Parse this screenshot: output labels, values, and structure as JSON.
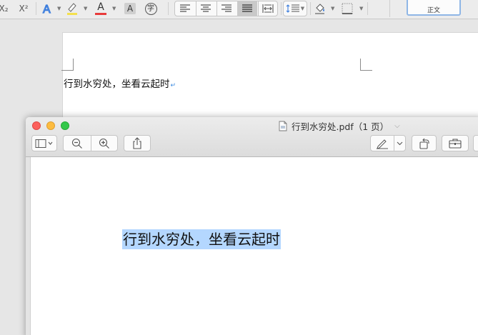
{
  "word": {
    "toolbar": {
      "subscript_label": "X₂",
      "superscript_label": "X²",
      "font_color_label": "A",
      "shading_label": "A",
      "phonetic_label": "字",
      "style_label": "正文",
      "colors": {
        "highlight": "#f4e04d",
        "font_color": "#e83b3b",
        "accent": "#3b7ddd"
      }
    },
    "document": {
      "text": "行到水穷处，坐看云起时",
      "paragraph_mark": "↵"
    }
  },
  "preview": {
    "title": "行到水穷处.pdf（1 页）",
    "toolbar_icons": [
      "sidebar-icon",
      "zoom-out-icon",
      "zoom-in-icon",
      "share-icon",
      "markup-pen-icon",
      "rotate-icon",
      "toolbox-icon"
    ],
    "pdf_text": "行到水穷处，坐看云起时"
  }
}
